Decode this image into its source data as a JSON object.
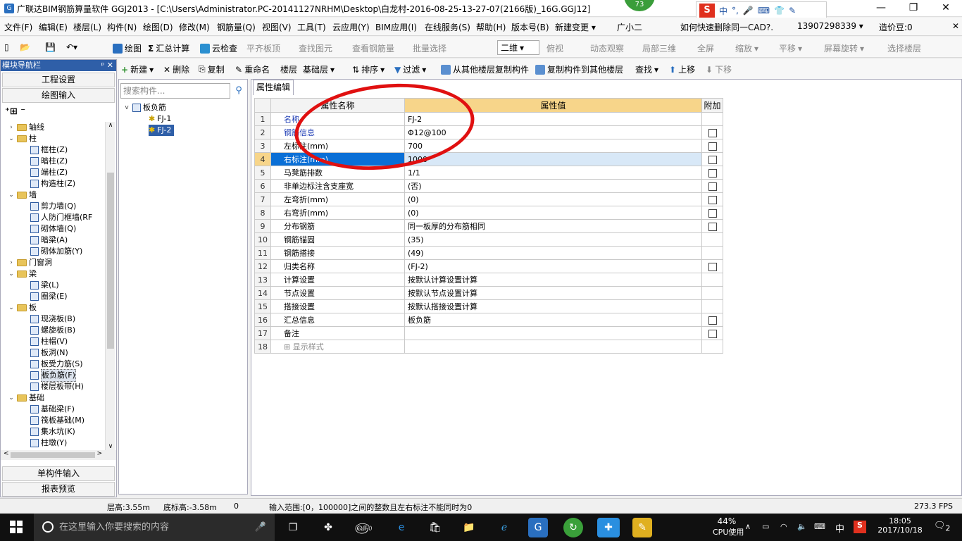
{
  "window": {
    "title": "广联达BIM钢筋算量软件 GGJ2013 - [C:\\Users\\Administrator.PC-20141127NRHM\\Desktop\\白龙村-2016-08-25-13-27-07(2166版)_16G.GGJ12]",
    "badge": "73"
  },
  "ime": {
    "items": [
      "中",
      "°,",
      "🎤",
      "⌨",
      "👕",
      "✎"
    ]
  },
  "menu": [
    "文件(F)",
    "编辑(E)",
    "楼层(L)",
    "构件(N)",
    "绘图(D)",
    "修改(M)",
    "钢筋量(Q)",
    "视图(V)",
    "工具(T)",
    "云应用(Y)",
    "BIM应用(I)",
    "在线服务(S)",
    "帮助(H)",
    "版本号(B)",
    "新建变更 ▾",
    "广小二",
    "如何快速删除同一CAD?.",
    "13907298339 ▾",
    "造价豆:0"
  ],
  "toolbar1": {
    "draw": "绘图",
    "sum": "汇总计算",
    "cloud": "云检查",
    "flat": "平齐板顶",
    "find": "查找图元",
    "viewrebar": "查看钢筋量",
    "batch": "批量选择",
    "view2d": "二维",
    "top": "俯视",
    "dyn": "动态观察",
    "local3d": "局部三维",
    "full": "全屏",
    "zoom": "缩放",
    "pan": "平移",
    "rotate": "屏幕旋转",
    "selfloor": "选择楼层"
  },
  "toolbar2": {
    "new": "新建",
    "del": "删除",
    "copy": "复制",
    "rename": "重命名",
    "floor": "楼层",
    "floorval": "基础层",
    "sort": "排序",
    "filter": "过滤",
    "copyfrom": "从其他楼层复制构件",
    "copyto": "复制构件到其他楼层",
    "search": "查找",
    "up": "上移",
    "down": "下移"
  },
  "nav": {
    "header": "模块导航栏",
    "btn1": "工程设置",
    "btn2": "绘图输入",
    "btn3": "单构件输入",
    "btn4": "报表预览",
    "tree": [
      {
        "t": "轴线",
        "lvl": 0,
        "f": true,
        "tg": ">"
      },
      {
        "t": "柱",
        "lvl": 0,
        "f": true,
        "tg": "v"
      },
      {
        "t": "框柱(Z)",
        "lvl": 1
      },
      {
        "t": "暗柱(Z)",
        "lvl": 1
      },
      {
        "t": "端柱(Z)",
        "lvl": 1
      },
      {
        "t": "构造柱(Z)",
        "lvl": 1
      },
      {
        "t": "墙",
        "lvl": 0,
        "f": true,
        "tg": "v"
      },
      {
        "t": "剪力墙(Q)",
        "lvl": 1
      },
      {
        "t": "人防门框墙(RF",
        "lvl": 1
      },
      {
        "t": "砌体墙(Q)",
        "lvl": 1
      },
      {
        "t": "暗梁(A)",
        "lvl": 1
      },
      {
        "t": "砌体加筋(Y)",
        "lvl": 1
      },
      {
        "t": "门窗洞",
        "lvl": 0,
        "f": true,
        "tg": ">"
      },
      {
        "t": "梁",
        "lvl": 0,
        "f": true,
        "tg": "v"
      },
      {
        "t": "梁(L)",
        "lvl": 1
      },
      {
        "t": "圈梁(E)",
        "lvl": 1
      },
      {
        "t": "板",
        "lvl": 0,
        "f": true,
        "tg": "v"
      },
      {
        "t": "现浇板(B)",
        "lvl": 1
      },
      {
        "t": "螺旋板(B)",
        "lvl": 1
      },
      {
        "t": "柱帽(V)",
        "lvl": 1
      },
      {
        "t": "板洞(N)",
        "lvl": 1
      },
      {
        "t": "板受力筋(S)",
        "lvl": 1
      },
      {
        "t": "板负筋(F)",
        "lvl": 1,
        "sel": true
      },
      {
        "t": "楼层板带(H)",
        "lvl": 1
      },
      {
        "t": "基础",
        "lvl": 0,
        "f": true,
        "tg": "v"
      },
      {
        "t": "基础梁(F)",
        "lvl": 1
      },
      {
        "t": "筏板基础(M)",
        "lvl": 1
      },
      {
        "t": "集水坑(K)",
        "lvl": 1
      },
      {
        "t": "柱墩(Y)",
        "lvl": 1
      }
    ]
  },
  "comp": {
    "placeholder": "搜索构件...",
    "root": "板负筋",
    "items": [
      "FJ-1",
      "FJ-2"
    ]
  },
  "props": {
    "tab": "属性编辑",
    "col_name": "属性名称",
    "col_val": "属性值",
    "col_add": "附加",
    "rows": [
      {
        "n": "1",
        "name": "名称",
        "val": "FJ-2",
        "blue": true,
        "cb": false
      },
      {
        "n": "2",
        "name": "钢筋信息",
        "val": "Φ12@100",
        "blue": true,
        "cb": true
      },
      {
        "n": "3",
        "name": "左标注(mm)",
        "val": "700",
        "cb": true
      },
      {
        "n": "4",
        "name": "右标注(mm)",
        "val": "1000",
        "cb": true,
        "sel": true
      },
      {
        "n": "5",
        "name": "马凳筋排数",
        "val": "1/1",
        "cb": true
      },
      {
        "n": "6",
        "name": "非单边标注含支座宽",
        "val": "(否)",
        "cb": true
      },
      {
        "n": "7",
        "name": "左弯折(mm)",
        "val": "(0)",
        "cb": true
      },
      {
        "n": "8",
        "name": "右弯折(mm)",
        "val": "(0)",
        "cb": true
      },
      {
        "n": "9",
        "name": "分布钢筋",
        "val": "同一板厚的分布筋相同",
        "cb": true
      },
      {
        "n": "10",
        "name": "钢筋锚固",
        "val": "(35)",
        "cb": false
      },
      {
        "n": "11",
        "name": "钢筋搭接",
        "val": "(49)",
        "cb": false
      },
      {
        "n": "12",
        "name": "归类名称",
        "val": "(FJ-2)",
        "cb": true
      },
      {
        "n": "13",
        "name": "计算设置",
        "val": "按默认计算设置计算",
        "cb": false
      },
      {
        "n": "14",
        "name": "节点设置",
        "val": "按默认节点设置计算",
        "cb": false
      },
      {
        "n": "15",
        "name": "搭接设置",
        "val": "按默认搭接设置计算",
        "cb": false
      },
      {
        "n": "16",
        "name": "汇总信息",
        "val": "板负筋",
        "cb": true
      },
      {
        "n": "17",
        "name": "备注",
        "val": "",
        "cb": true
      },
      {
        "n": "18",
        "name": "⊞ 显示样式",
        "val": "",
        "cb": false,
        "gray": true
      }
    ]
  },
  "status": {
    "floorh": "层高:3.55m",
    "baseh": "底标高:-3.58m",
    "zero": "0",
    "hint": "输入范围:[0，100000]之间的整数且左右标注不能同时为0",
    "fps": "273.3 FPS"
  },
  "taskbar": {
    "search": "在这里输入你要搜索的内容",
    "cpu": "44%",
    "cpulabel": "CPU使用",
    "lang": "中",
    "time": "18:05",
    "date": "2017/10/18",
    "notif": "2"
  }
}
